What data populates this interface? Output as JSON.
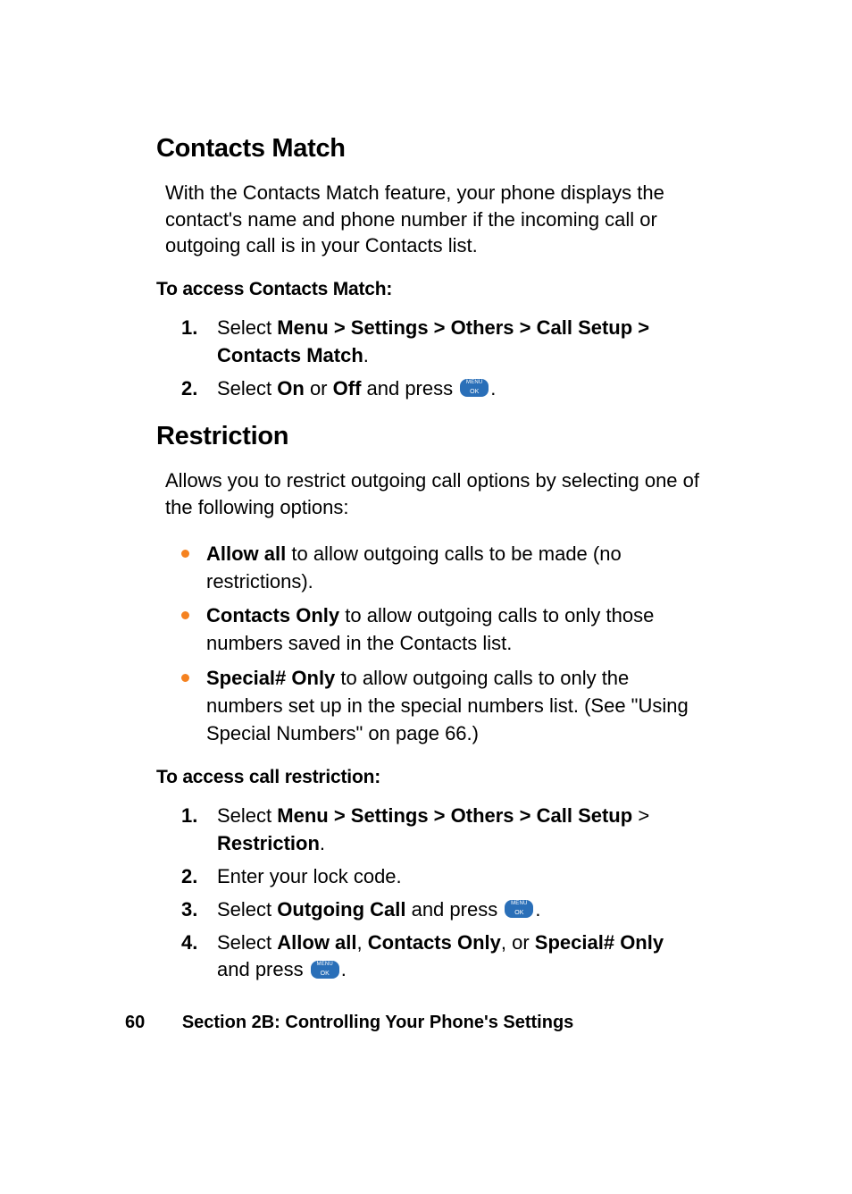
{
  "section1": {
    "heading": "Contacts Match",
    "intro": "With the Contacts Match feature, your phone displays the contact's name and phone number if the incoming call or outgoing call is in your Contacts list.",
    "leadin": "To access Contacts Match:",
    "steps": {
      "s1_num": "1.",
      "s1_pre": "Select ",
      "s1_bold": "Menu > Settings > Others > Call Setup > Contacts Match",
      "s1_post": ".",
      "s2_num": "2.",
      "s2_a": "Select ",
      "s2_on": "On",
      "s2_b": " or ",
      "s2_off": "Off",
      "s2_c": " and press ",
      "s2_d": "."
    }
  },
  "section2": {
    "heading": "Restriction",
    "intro": "Allows you to restrict outgoing call options by selecting one of the following options:",
    "bullets": {
      "b1_bold": "Allow all",
      "b1_rest": " to allow outgoing calls to be made (no restrictions).",
      "b2_bold": "Contacts Only",
      "b2_rest": " to allow outgoing calls to only those numbers saved in the Contacts list.",
      "b3_bold": "Special# Only",
      "b3_rest": " to allow outgoing calls to only the numbers set up in the special numbers list. (See \"Using Special Numbers\" on page 66.)"
    },
    "leadin": "To access call restriction:",
    "steps": {
      "s1_num": "1.",
      "s1_a": "Select ",
      "s1_bold": "Menu > Settings > Others > Call Setup",
      "s1_b": " > ",
      "s1_bold2": "Restriction",
      "s1_c": ".",
      "s2_num": "2.",
      "s2_text": "Enter your lock code.",
      "s3_num": "3.",
      "s3_a": "Select ",
      "s3_bold": "Outgoing Call",
      "s3_b": " and press ",
      "s3_c": ".",
      "s4_num": "4.",
      "s4_a": "Select ",
      "s4_bold1": "Allow all",
      "s4_b": ", ",
      "s4_bold2": "Contacts Only",
      "s4_c": ", or ",
      "s4_bold3": "Special# Only",
      "s4_d": " and press ",
      "s4_e": "."
    }
  },
  "footer": {
    "page": "60",
    "title": "Section 2B: Controlling Your Phone's Settings"
  }
}
